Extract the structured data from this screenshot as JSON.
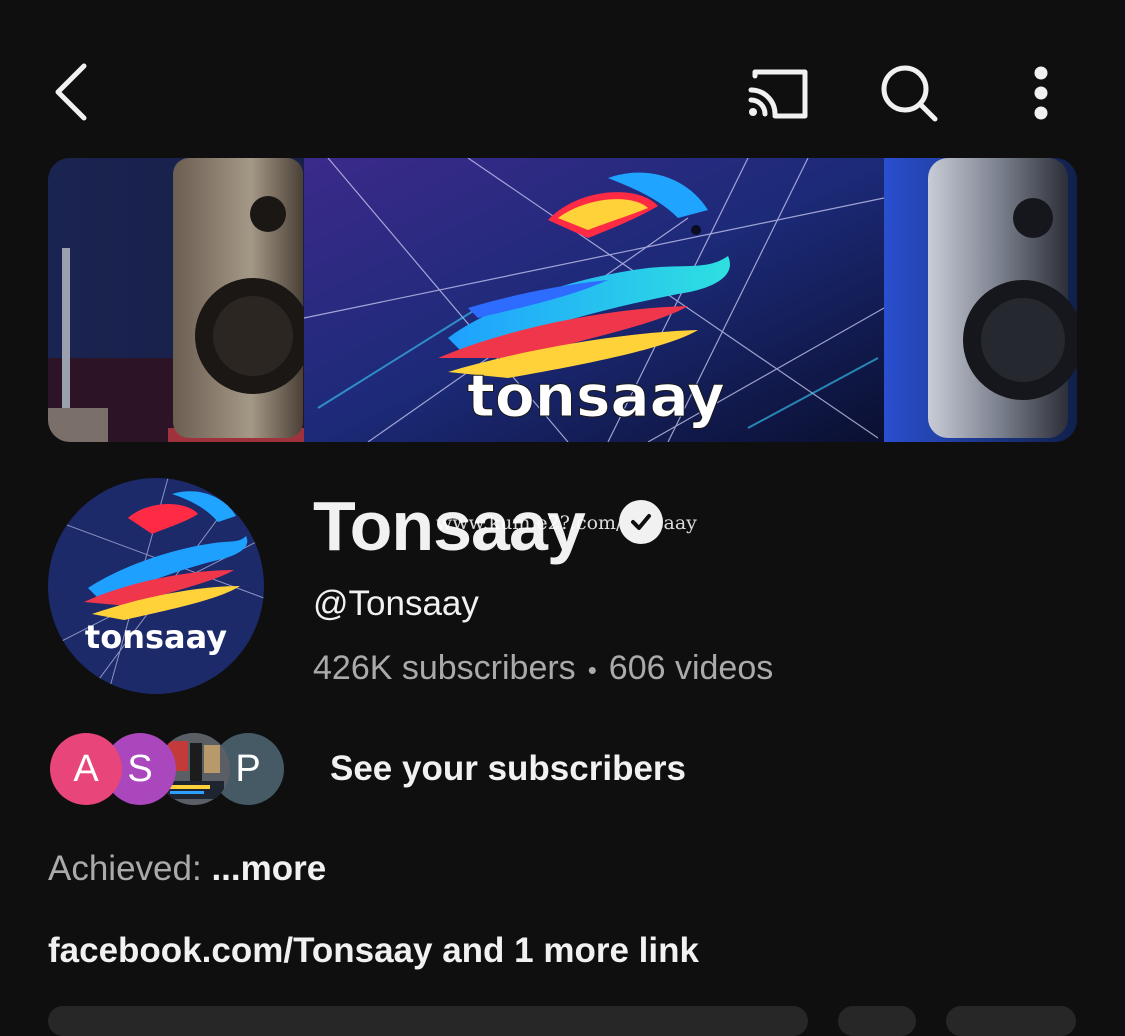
{
  "colors": {
    "background": "#0f0f0f",
    "text_primary": "#f1f1f1",
    "text_secondary": "#aaaaaa",
    "avatar_a": "#e8467a",
    "avatar_s": "#ab47bc",
    "avatar_p": "#455a64"
  },
  "topbar": {
    "back_icon": "chevron-left-icon",
    "cast_icon": "cast-icon",
    "search_icon": "search-icon",
    "more_icon": "more-vertical-icon"
  },
  "banner": {
    "logo_text": "tonsaay"
  },
  "avatar": {
    "logo_text": "tonsaay"
  },
  "channel": {
    "name": "Tonsaay",
    "handle": "@Tonsaay",
    "subscribers": "426K subscribers",
    "separator": "•",
    "videos": "606 videos",
    "watermark": "www.kum.e2?.com/tonsaay"
  },
  "subscribers_row": {
    "avatars": [
      {
        "letter": "A"
      },
      {
        "letter": "S"
      },
      {
        "letter": ""
      },
      {
        "letter": "P"
      }
    ],
    "label": "See your subscribers"
  },
  "description": {
    "label": "Achieved: ",
    "more": "...more"
  },
  "links": {
    "text": "facebook.com/Tonsaay and 1 more link"
  }
}
